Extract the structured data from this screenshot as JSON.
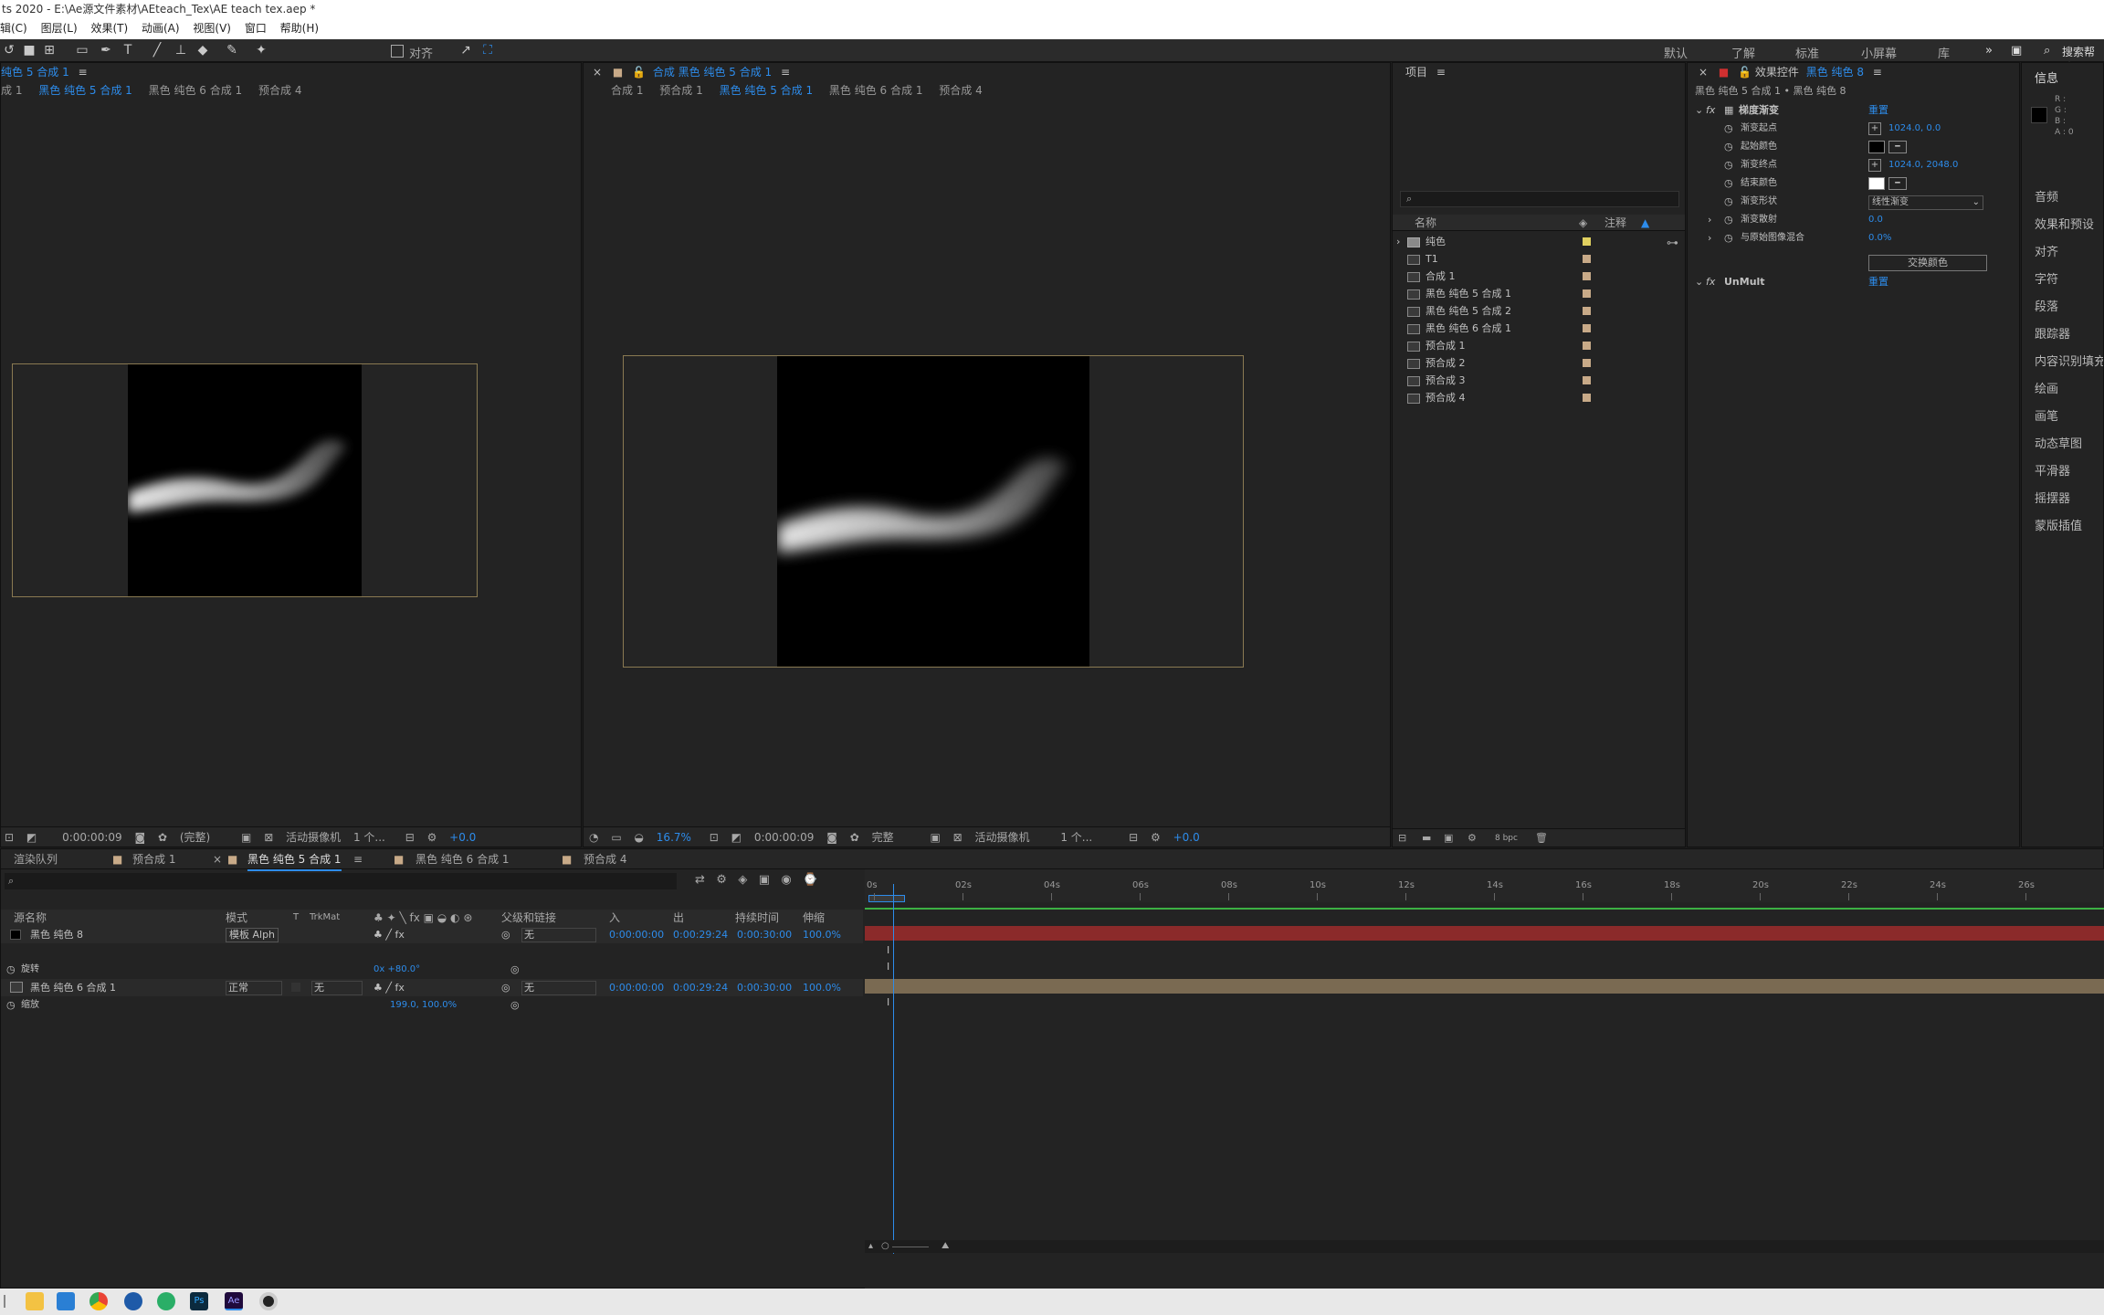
{
  "titlebar": {
    "text": "ts 2020 - E:\\Ae源文件素材\\AEteach_Tex\\AE teach tex.aep *"
  },
  "menu": [
    "辑(C)",
    "图层(L)",
    "效果(T)",
    "动画(A)",
    "视图(V)",
    "窗口",
    "帮助(H)"
  ],
  "toolbar": {
    "align_label": "对齐",
    "workspaces": [
      "默认",
      "了解",
      "标准",
      "小屏幕",
      "库"
    ],
    "search_label": "搜索帮助"
  },
  "left_viewer": {
    "tab_title": "纯色 5 合成 1",
    "crumbs": [
      "成 1",
      "黑色 纯色 5 合成 1",
      "黑色 纯色 6 合成 1",
      "预合成 4"
    ],
    "footer": {
      "time": "0:00:00:09",
      "resolution": "(完整)",
      "camera": "活动摄像机",
      "views": "1 个...",
      "exposure": "+0.0"
    }
  },
  "center_viewer": {
    "tab_title": "合成 黑色 纯色 5 合成 1",
    "crumbs": [
      "合成 1",
      "预合成 1",
      "黑色 纯色 5 合成 1",
      "黑色 纯色 6 合成 1",
      "预合成 4"
    ],
    "footer": {
      "zoom": "16.7%",
      "time": "0:00:00:09",
      "resolution": "完整",
      "camera": "活动摄像机",
      "views": "1 个...",
      "exposure": "+0.0"
    }
  },
  "project": {
    "title": "项目",
    "search_placeholder": "",
    "col_name": "名称",
    "col_comment": "注释",
    "items": [
      {
        "name": "纯色",
        "type": "folder",
        "color": "#e0d060"
      },
      {
        "name": "T1",
        "type": "comp",
        "color": "#c8aa88"
      },
      {
        "name": "合成 1",
        "type": "comp",
        "color": "#c8aa88"
      },
      {
        "name": "黑色 纯色 5 合成 1",
        "type": "comp",
        "color": "#c8aa88"
      },
      {
        "name": "黑色 纯色 5 合成 2",
        "type": "comp",
        "color": "#c8aa88"
      },
      {
        "name": "黑色 纯色 6 合成 1",
        "type": "comp",
        "color": "#c8aa88"
      },
      {
        "name": "预合成 1",
        "type": "comp",
        "color": "#c8aa88"
      },
      {
        "name": "预合成 2",
        "type": "comp",
        "color": "#c8aa88"
      },
      {
        "name": "预合成 3",
        "type": "comp",
        "color": "#c8aa88"
      },
      {
        "name": "预合成 4",
        "type": "comp",
        "color": "#c8aa88"
      }
    ],
    "footer_bpc": "8 bpc"
  },
  "effects": {
    "title": "效果控件",
    "layer_name": "黑色 纯色 8",
    "subtitle": "黑色 纯色 5 合成 1 • 黑色 纯色 8",
    "effect1": {
      "name": "梯度渐变",
      "reset": "重置"
    },
    "params": [
      {
        "label": "渐变起点",
        "value": "1024.0, 0.0",
        "kind": "point"
      },
      {
        "label": "起始颜色",
        "value": "",
        "kind": "color-black"
      },
      {
        "label": "渐变终点",
        "value": "1024.0, 2048.0",
        "kind": "point"
      },
      {
        "label": "结束颜色",
        "value": "",
        "kind": "color-white"
      },
      {
        "label": "渐变形状",
        "value": "线性渐变",
        "kind": "dropdown"
      },
      {
        "label": "渐变散射",
        "value": "0.0",
        "kind": "number"
      },
      {
        "label": "与原始图像混合",
        "value": "0.0%",
        "kind": "number"
      }
    ],
    "swap_button": "交换颜色",
    "effect2": {
      "name": "UnMult",
      "reset": "重置"
    }
  },
  "right_panel": {
    "info_title": "信息",
    "rgba": [
      "R :",
      "G :",
      "B :",
      "A : 0"
    ],
    "items": [
      "音频",
      "效果和预设",
      "对齐",
      "字符",
      "段落",
      "跟踪器",
      "内容识别填充",
      "绘画",
      "画笔",
      "动态草图",
      "平滑器",
      "摇摆器",
      "蒙版插值"
    ]
  },
  "timeline": {
    "tabs": [
      "渲染队列",
      "预合成 1",
      "黑色 纯色 5 合成 1",
      "黑色 纯色 6 合成 1",
      "预合成 4"
    ],
    "columns": {
      "source": "源名称",
      "mode": "模式",
      "t": "T",
      "trkmat": "TrkMat",
      "parent": "父级和链接",
      "in": "入",
      "out": "出",
      "duration": "持续时间",
      "stretch": "伸缩"
    },
    "layers": [
      {
        "name": "黑色 纯色 8",
        "mode": "模板 Alph",
        "parent": "无",
        "in": "0:00:00:00",
        "out": "0:00:29:24",
        "duration": "0:00:30:00",
        "stretch": "100.0%"
      },
      {
        "name": "黑色 纯色 6 合成 1",
        "mode": "正常",
        "trkmat": "无",
        "parent": "无",
        "in": "0:00:00:00",
        "out": "0:00:29:24",
        "duration": "0:00:30:00",
        "stretch": "100.0%"
      }
    ],
    "prop_rotation": {
      "label": "旋转",
      "value": "0x +80.0°"
    },
    "prop_scale": {
      "label": "缩放",
      "value": "199.0, 100.0%"
    },
    "ruler": [
      "0s",
      "02s",
      "04s",
      "06s",
      "08s",
      "10s",
      "12s",
      "14s",
      "16s",
      "18s",
      "20s",
      "22s",
      "24s",
      "26s"
    ],
    "playhead_seconds": 0.3
  },
  "taskbar": {
    "icons": [
      "start-icon",
      "file-explorer-icon",
      "mail-icon",
      "chrome-icon",
      "app-icon",
      "wechat-icon",
      "photoshop-icon",
      "after-effects-icon",
      "recorder-icon"
    ]
  }
}
